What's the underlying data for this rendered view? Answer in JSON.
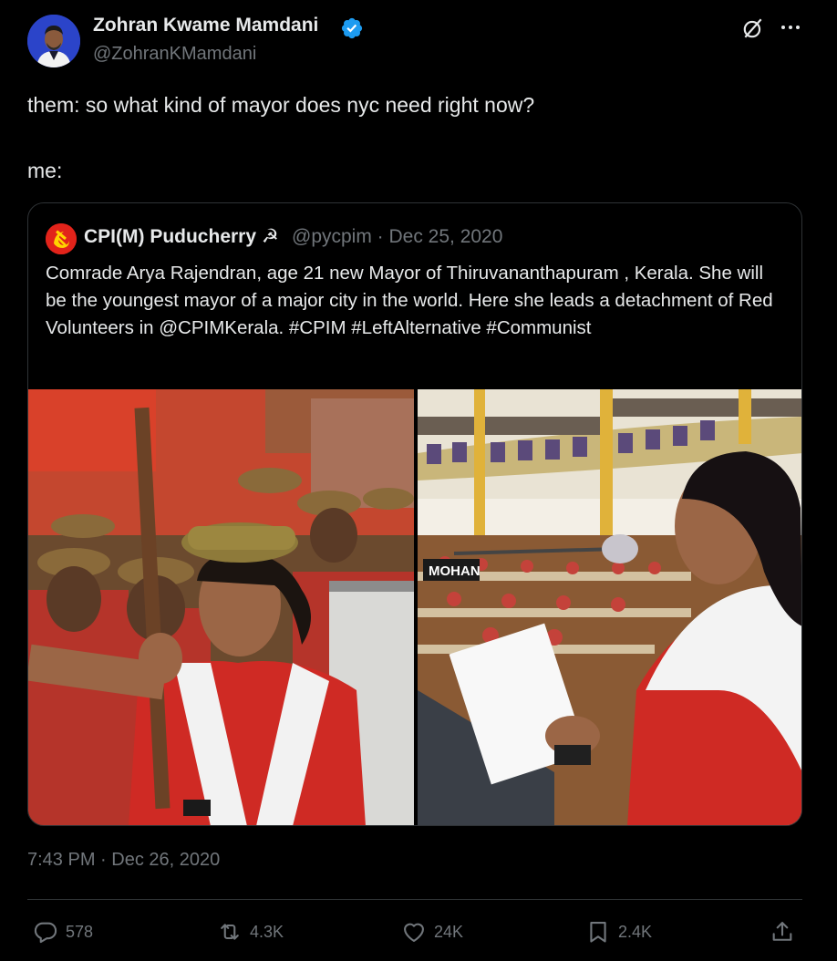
{
  "author": {
    "name": "Zohran Kwame Mamdani",
    "handle": "@ZohranKMamdani",
    "verified_color": "#1d9bf0"
  },
  "header_icons": [
    "grok-icon",
    "more-icon"
  ],
  "tweet": {
    "line1": "them: so what kind of mayor does nyc need right now?",
    "line2": "me:"
  },
  "quote": {
    "name": "CPI(M) Puducherry",
    "name_emoji": "☭",
    "handle_date": "@pycpim · Dec 25, 2020",
    "text": "Comrade Arya Rajendran, age 21  new Mayor of Thiruvananthapuram , Kerala. She will be the youngest mayor of a major city in the world. Here she leads a detachment of Red Volunteers in @CPIMKerala. #CPIM  #LeftAlternative #Communist",
    "images": [
      {
        "name": "photo-red-volunteers"
      },
      {
        "name": "photo-council-hall",
        "nameplate": "MOHAN"
      }
    ]
  },
  "timestamp": "7:43 PM · Dec 26, 2020",
  "actions": {
    "replies": "578",
    "reposts": "4.3K",
    "likes": "24K",
    "bookmarks": "2.4K"
  },
  "colors": {
    "background": "#000000",
    "text": "#e7e9ea",
    "muted": "#71767b",
    "border": "#2f3336",
    "accent": "#1d9bf0",
    "cpim_red": "#e2231a"
  }
}
